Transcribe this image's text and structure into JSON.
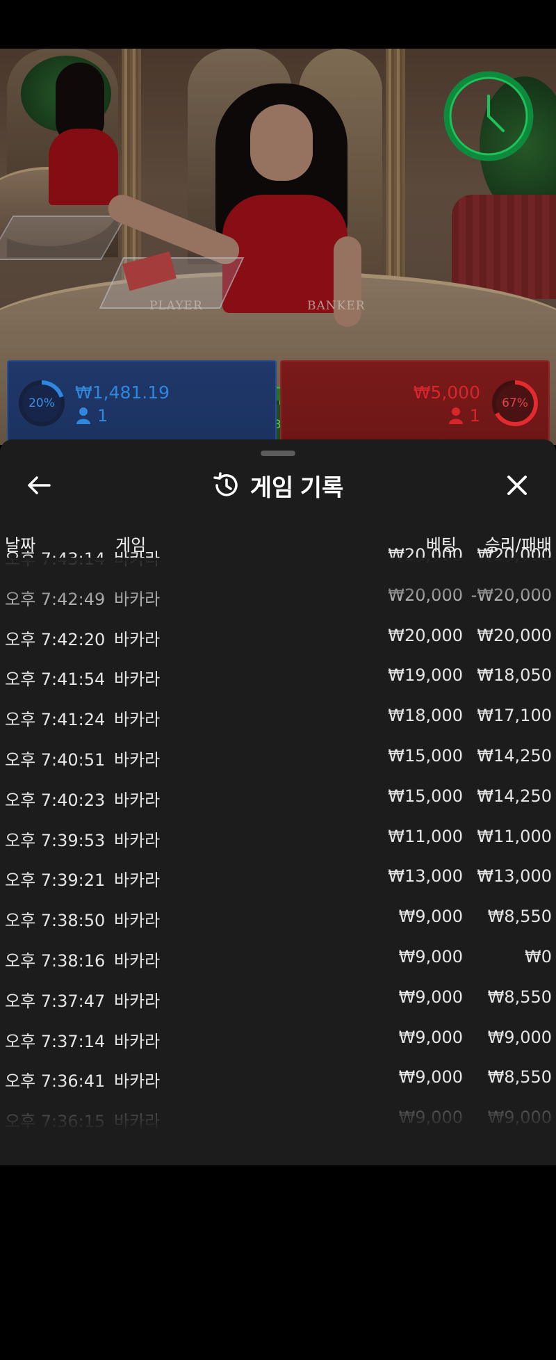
{
  "video": {
    "table_labels": {
      "player": "PLAYER",
      "banker": "BANKER"
    }
  },
  "bets": {
    "player": {
      "percent": "20%",
      "amount": "₩1,481.19",
      "players": "1",
      "color": "#2a7fd4"
    },
    "tie": {
      "percent": "13%",
      "color": "#37b84a"
    },
    "banker": {
      "percent": "67%",
      "amount": "₩5,000",
      "players": "1",
      "color": "#d8252b"
    }
  },
  "history": {
    "title": "게임 기록",
    "columns": {
      "date": "날짜",
      "game": "게임",
      "bet": "베팅",
      "result": "승리/패배"
    },
    "rows": [
      {
        "time": "오후 7:43:14",
        "game": "바카라",
        "bet": "₩20,000",
        "result": "₩20,000"
      },
      {
        "time": "오후 7:42:49",
        "game": "바카라",
        "bet": "₩20,000",
        "result": "-₩20,000"
      },
      {
        "time": "오후 7:42:20",
        "game": "바카라",
        "bet": "₩20,000",
        "result": "₩20,000"
      },
      {
        "time": "오후 7:41:54",
        "game": "바카라",
        "bet": "₩19,000",
        "result": "₩18,050"
      },
      {
        "time": "오후 7:41:24",
        "game": "바카라",
        "bet": "₩18,000",
        "result": "₩17,100"
      },
      {
        "time": "오후 7:40:51",
        "game": "바카라",
        "bet": "₩15,000",
        "result": "₩14,250"
      },
      {
        "time": "오후 7:40:23",
        "game": "바카라",
        "bet": "₩15,000",
        "result": "₩14,250"
      },
      {
        "time": "오후 7:39:53",
        "game": "바카라",
        "bet": "₩11,000",
        "result": "₩11,000"
      },
      {
        "time": "오후 7:39:21",
        "game": "바카라",
        "bet": "₩13,000",
        "result": "₩13,000"
      },
      {
        "time": "오후 7:38:50",
        "game": "바카라",
        "bet": "₩9,000",
        "result": "₩8,550"
      },
      {
        "time": "오후 7:38:16",
        "game": "바카라",
        "bet": "₩9,000",
        "result": "₩0"
      },
      {
        "time": "오후 7:37:47",
        "game": "바카라",
        "bet": "₩9,000",
        "result": "₩8,550"
      },
      {
        "time": "오후 7:37:14",
        "game": "바카라",
        "bet": "₩9,000",
        "result": "₩9,000"
      },
      {
        "time": "오후 7:36:41",
        "game": "바카라",
        "bet": "₩9,000",
        "result": "₩8,550"
      },
      {
        "time": "오후 7:36:15",
        "game": "바카라",
        "bet": "₩9,000",
        "result": "₩9,000"
      }
    ]
  },
  "icons": {
    "back": "arrow-left-icon",
    "history": "history-clock-icon",
    "close": "close-icon",
    "timer": "clock-icon",
    "player": "person-icon"
  }
}
